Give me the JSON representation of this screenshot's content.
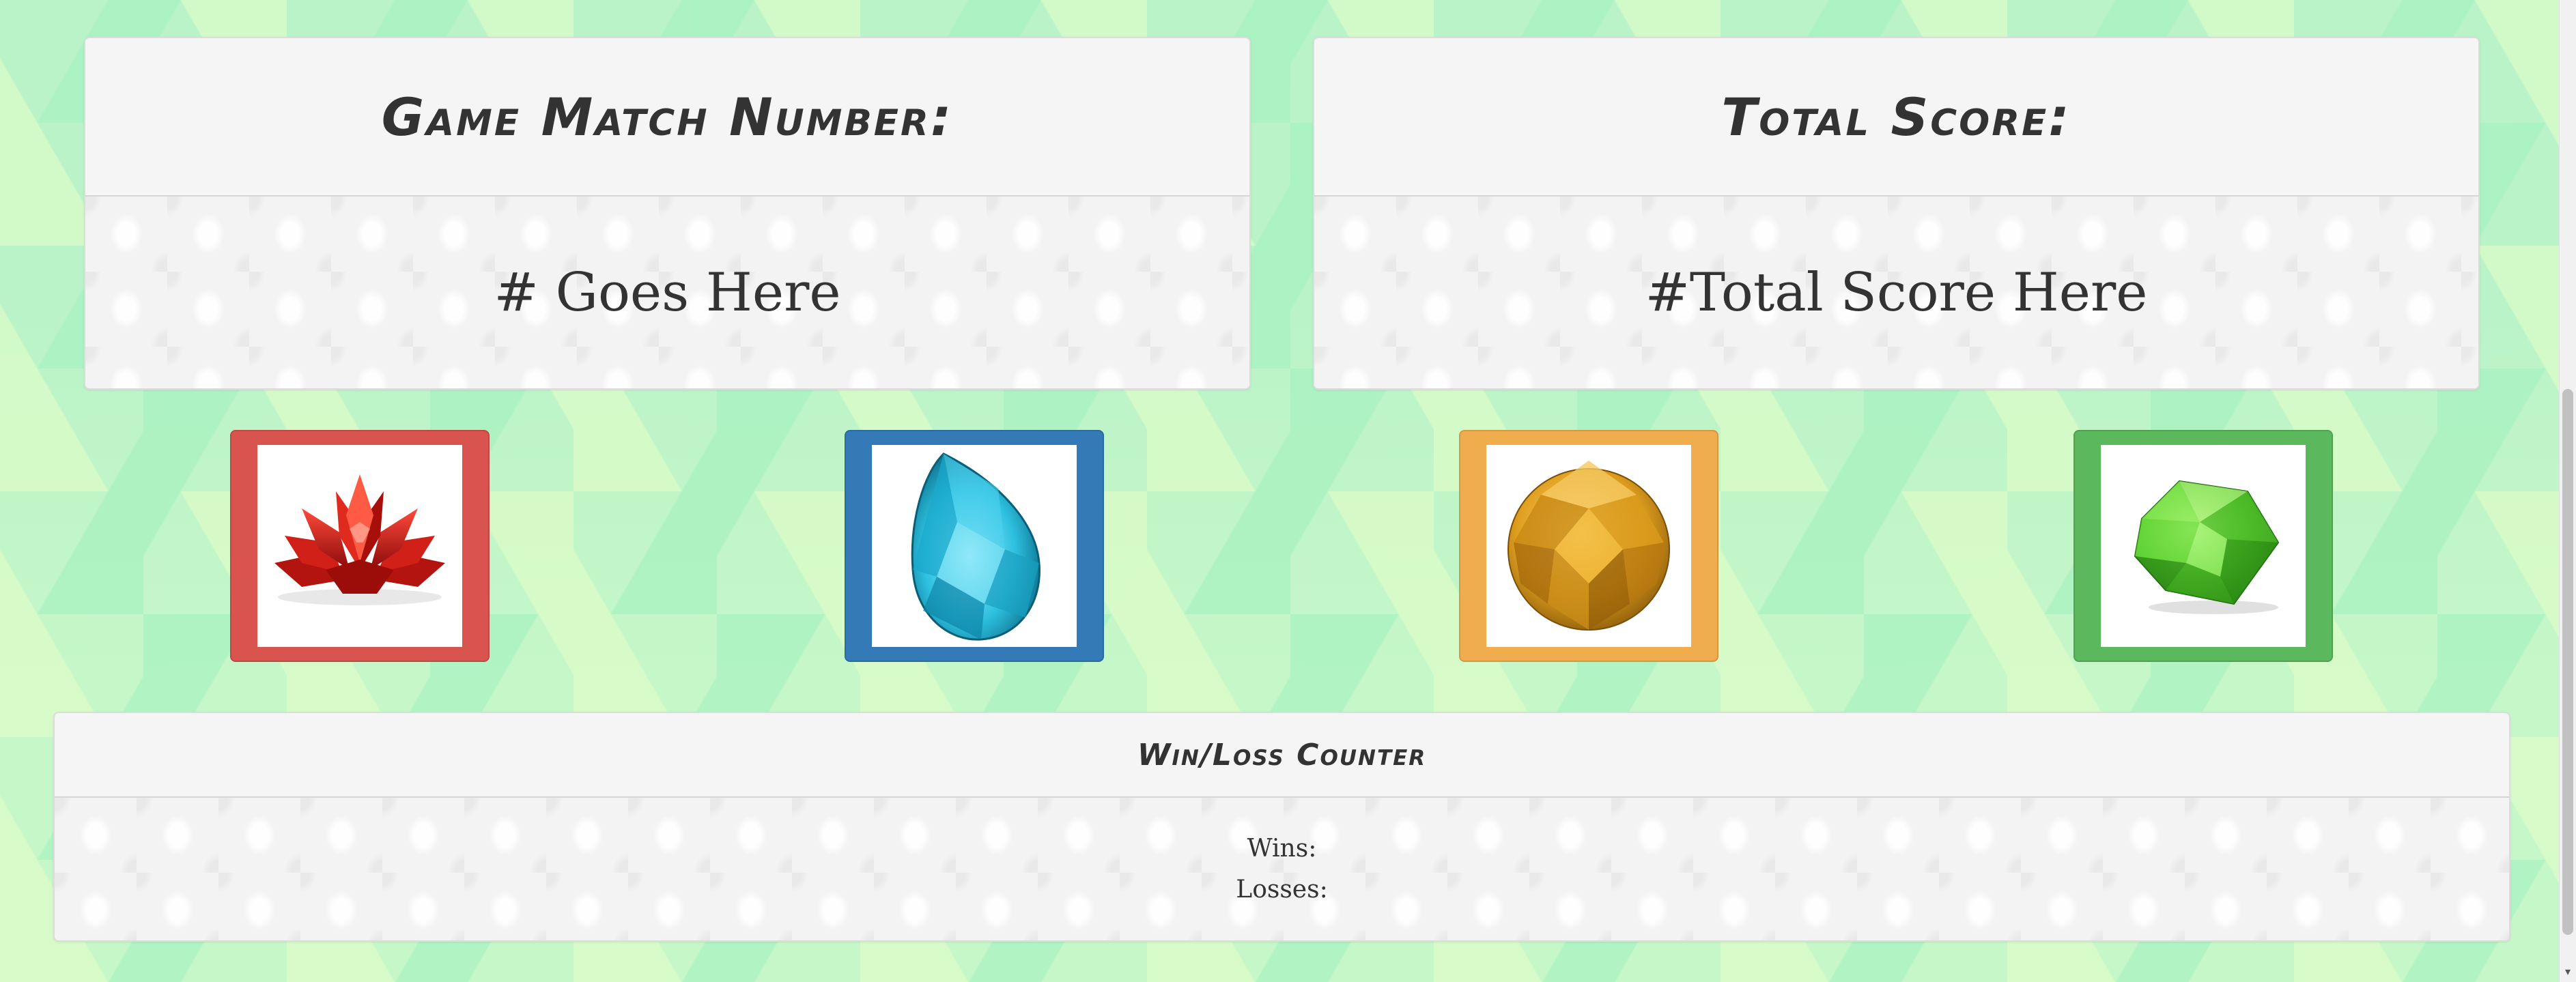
{
  "match_panel": {
    "heading": "Game Match Number:",
    "value": "# Goes Here"
  },
  "score_panel": {
    "heading": "Total Score:",
    "value": "#Total Score Here"
  },
  "crystals": [
    {
      "gem": "red-lotus-crystal",
      "color": "#d9534f"
    },
    {
      "gem": "blue-teardrop-crystal",
      "color": "#337ab7"
    },
    {
      "gem": "amber-sphere-crystal",
      "color": "#f0ad4e"
    },
    {
      "gem": "green-diamond-crystal",
      "color": "#5cb85c"
    }
  ],
  "counter_panel": {
    "heading": "Win/Loss Counter",
    "wins_label": "Wins:",
    "losses_label": "Losses:"
  },
  "scrollbar": {
    "down_arrow": "▾"
  }
}
